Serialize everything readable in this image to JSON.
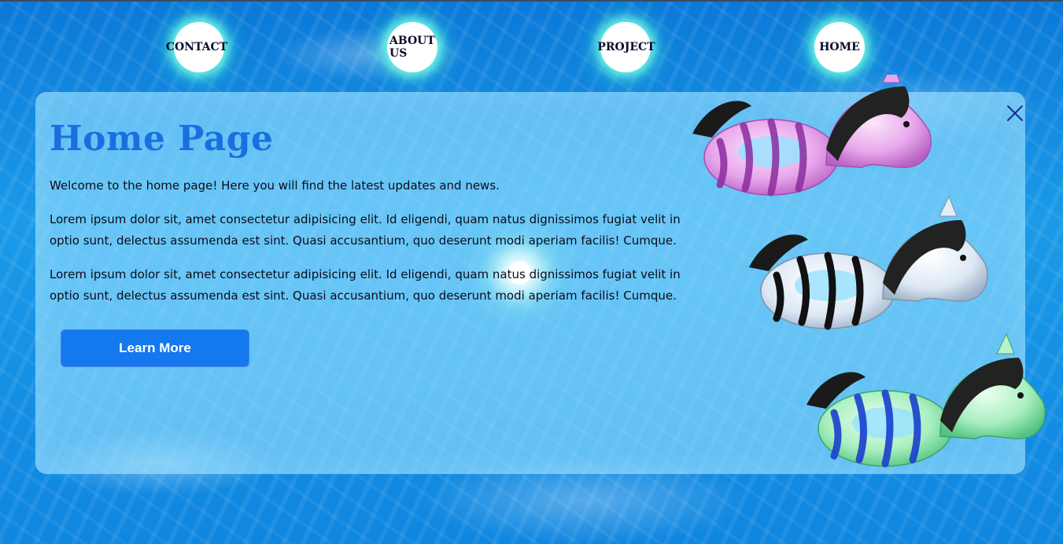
{
  "nav": {
    "items": [
      {
        "label": "CONTACT"
      },
      {
        "label": "ABOUT US"
      },
      {
        "label": "PROJECT"
      },
      {
        "label": "HOME"
      }
    ]
  },
  "main": {
    "title": "Home Page",
    "intro": "Welcome to the home page! Here you will find the latest updates and news.",
    "paragraphs": [
      "Lorem ipsum dolor sit, amet consectetur adipisicing elit. Id eligendi, quam natus dignissimos fugiat velit in optio sunt, delectus assumenda est sint. Quasi accusantium, quo deserunt modi aperiam facilis! Cumque.",
      "Lorem ipsum dolor sit, amet consectetur adipisicing elit. Id eligendi, quam natus dignissimos fugiat velit in optio sunt, delectus assumenda est sint. Quasi accusantium, quo deserunt modi aperiam facilis! Cumque."
    ],
    "button_label": "Learn More"
  },
  "icons": {
    "close": "close-icon",
    "decoration": "horse-pool-float-illustration"
  },
  "colors": {
    "title": "#1a6fe0",
    "button": "#1478ee",
    "nav_glow": "#3ce6d2",
    "close_icon": "#1a2a9a"
  }
}
